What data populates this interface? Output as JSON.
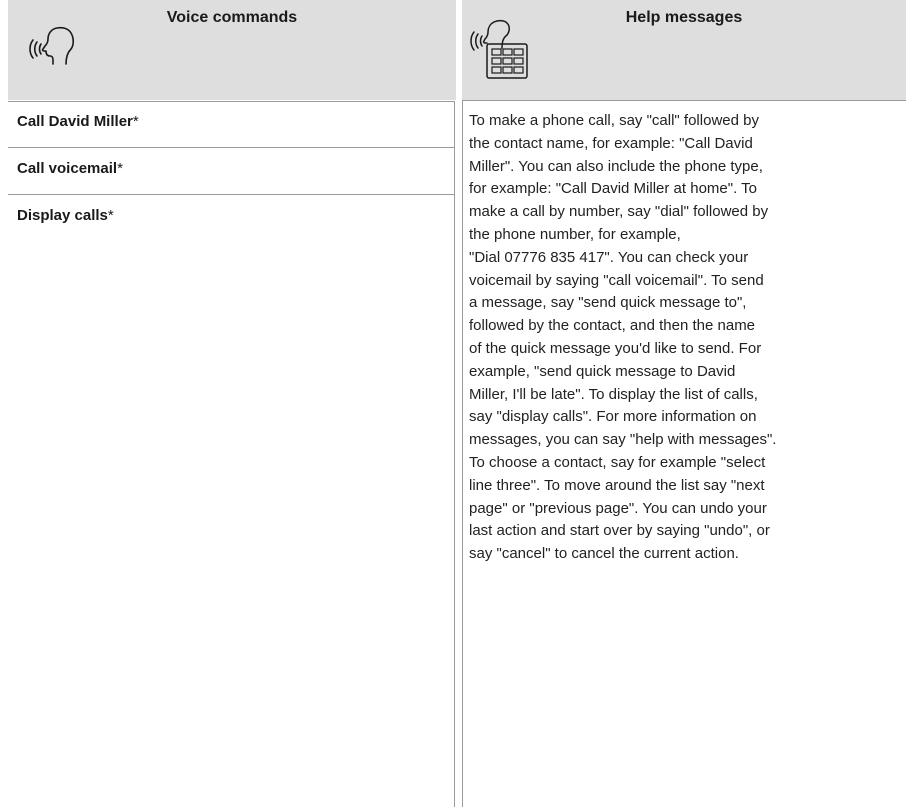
{
  "header": {
    "left_title": "Voice commands",
    "right_title": "Help messages",
    "left_icon": "speaking-head-icon",
    "right_icon": "speaking-keypad-icon"
  },
  "commands": [
    {
      "label": "Call David Miller",
      "marker": "*"
    },
    {
      "label": "Call voicemail",
      "marker": "*"
    },
    {
      "label": "Display calls",
      "marker": "*"
    }
  ],
  "help_message": "To make a phone call, say \"call\" followed by\nthe contact name, for example: \"Call David\nMiller\". You can also include the phone type,\nfor example: \"Call David Miller at home\". To\nmake a call by number, say \"dial\" followed by\nthe phone number, for example,\n\"Dial 07776 835 417\". You can check your\nvoicemail by saying \"call voicemail\". To send\na message, say \"send quick message to\",\nfollowed by the contact, and then the name\nof the quick message you'd like to send. For\nexample, \"send quick message to David\nMiller, I'll be late\". To display the list of calls,\nsay \"display calls\". For more information on\nmessages, you can say \"help with messages\".\nTo choose a contact, say for example \"select\nline three\". To move around the list say \"next\npage\" or \"previous page\". You can undo your\nlast action and start over by saying \"undo\", or\nsay \"cancel\" to cancel the current action.",
  "colors": {
    "header_background": "#dedede",
    "border": "#9a9a9a",
    "text": "#222222"
  }
}
